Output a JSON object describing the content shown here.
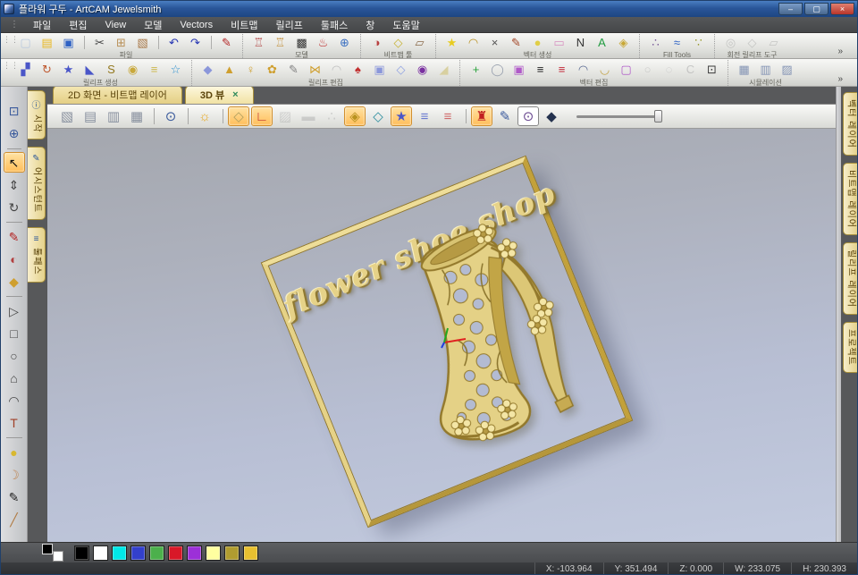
{
  "window": {
    "title": "플라워 구두 - ArtCAM Jewelsmith",
    "controls": [
      {
        "n": "minimize-button",
        "g": "–"
      },
      {
        "n": "maximize-button",
        "g": "▢"
      },
      {
        "n": "close-button",
        "g": "×",
        "cls": "close"
      }
    ]
  },
  "menu": {
    "items": [
      "파일",
      "편집",
      "View",
      "모델",
      "Vectors",
      "비트맵",
      "릴리프",
      "툴패스",
      "창",
      "도움말"
    ]
  },
  "toolbar_overflow": "»",
  "toolbar_row1": {
    "groups": [
      {
        "label": "파일",
        "icons": [
          {
            "n": "new-model-button",
            "g": "▢",
            "c": "#b9c9de"
          },
          {
            "n": "open-model-button",
            "g": "▤",
            "c": "#e9b822"
          },
          {
            "n": "save-model-button",
            "g": "▣",
            "c": "#2f62c4"
          },
          {
            "n": "cut-button",
            "g": "✂",
            "c": "#444",
            "cls": "sb"
          },
          {
            "n": "copy-button",
            "g": "⊞",
            "c": "#b89058"
          },
          {
            "n": "paste-button",
            "g": "▧",
            "c": "#a87848"
          },
          {
            "n": "undo-button",
            "g": "↶",
            "c": "#2636b2",
            "cls": "sb"
          },
          {
            "n": "redo-button",
            "g": "↷",
            "c": "#2636b2"
          },
          {
            "n": "notes-button",
            "g": "✎",
            "c": "#b22222",
            "cls": "sb"
          }
        ]
      },
      {
        "label": "모델",
        "icons": [
          {
            "n": "model-import-red-button",
            "g": "♖",
            "c": "#b04040"
          },
          {
            "n": "model-import-gold-button",
            "g": "♖",
            "c": "#c08a30"
          },
          {
            "n": "model-grayscale-button",
            "g": "▩",
            "c": "#333333"
          },
          {
            "n": "laser-scan-button",
            "g": "♨",
            "c": "#c03030"
          },
          {
            "n": "sphere-model-button",
            "g": "⊕",
            "c": "#3a6fc0"
          }
        ]
      },
      {
        "label": "비트맵 툴",
        "icons": [
          {
            "n": "bitmap-sculpt-button",
            "g": "◑",
            "c": "#b84040"
          },
          {
            "n": "bitmap-to-vector-button",
            "g": "◇",
            "c": "#c6b232"
          },
          {
            "n": "paint-tools-button",
            "g": "▱",
            "c": "#8a6a4a"
          }
        ]
      },
      {
        "label": "벡터 생성",
        "icons": [
          {
            "n": "wand-vector-button",
            "g": "★",
            "c": "#e8cc20"
          },
          {
            "n": "arc-vector-button",
            "g": "◠",
            "c": "#b89020"
          },
          {
            "n": "delete-node-button",
            "g": "×",
            "c": "#555555"
          },
          {
            "n": "curve-pencil-button",
            "g": "✎",
            "c": "#a04020"
          },
          {
            "n": "blob-vector-button",
            "g": "●",
            "c": "#e0ce46"
          },
          {
            "n": "vector-eraser-button",
            "g": "▭",
            "c": "#d890c0"
          },
          {
            "n": "nesting-button",
            "g": "N",
            "c": "#333333"
          },
          {
            "n": "ascii-import-button",
            "g": "A",
            "c": "#1f9a3f"
          },
          {
            "n": "relief-wrap-button",
            "g": "◈",
            "c": "#c8a838"
          }
        ]
      },
      {
        "label": "Fill Tools",
        "icons": [
          {
            "n": "fill-scatter-button",
            "g": "∴",
            "c": "#7a5a9a"
          },
          {
            "n": "fill-flow-button",
            "g": "≈",
            "c": "#2f62c4"
          },
          {
            "n": "fill-nodes-button",
            "g": "∵",
            "c": "#9a9a30"
          }
        ]
      },
      {
        "label": "회전 릴리프 도구",
        "icons": [
          {
            "n": "rotary-relief-button",
            "g": "◎",
            "c": "#999999",
            "cls": "dis"
          },
          {
            "n": "rotary-wrap-button",
            "g": "◇",
            "c": "#999999",
            "cls": "dis"
          },
          {
            "n": "rotary-flat-button",
            "g": "▱",
            "c": "#999999",
            "cls": "dis"
          }
        ]
      }
    ]
  },
  "toolbar_row2": {
    "groups": [
      {
        "label": "릴리프 생성",
        "icons": [
          {
            "n": "shape-editor-button",
            "g": "▞",
            "c": "#4a56c8"
          },
          {
            "n": "sweep-relief-button",
            "g": "↻",
            "c": "#c05a30"
          },
          {
            "n": "star-relief-button",
            "g": "★",
            "c": "#4a56c8"
          },
          {
            "n": "extrude-relief-button",
            "g": "◣",
            "c": "#4a56c8"
          },
          {
            "n": "spin-relief-button",
            "g": "S",
            "c": "#93781e"
          },
          {
            "n": "weave-relief-button",
            "g": "◉",
            "c": "#c9a93c"
          },
          {
            "n": "relief-layers-button",
            "g": "≡",
            "c": "#cdb94e"
          },
          {
            "n": "texture-relief-button",
            "g": "☆",
            "c": "#2a8fd0"
          }
        ]
      },
      {
        "label": "릴리프 편집",
        "icons": [
          {
            "n": "smooth-relief-button",
            "g": "◆",
            "c": "#8b97da"
          },
          {
            "n": "cone-relief-button",
            "g": "▲",
            "c": "#cf9f2e"
          },
          {
            "n": "pin-relief-button",
            "g": "♀",
            "c": "#cf9f2e"
          },
          {
            "n": "flower-relief-button",
            "g": "✿",
            "c": "#cf9f2e"
          },
          {
            "n": "sculpt-relief-button",
            "g": "✎",
            "c": "#808080"
          },
          {
            "n": "spinner-relief-button",
            "g": "⋈",
            "c": "#cf9f2e"
          },
          {
            "n": "dome-relief-button",
            "g": "◠",
            "c": "#bfbfbf"
          },
          {
            "n": "mushroom-relief-button",
            "g": "♠",
            "c": "#c23030"
          },
          {
            "n": "pillow-relief-button",
            "g": "▣",
            "c": "#8b97da"
          },
          {
            "n": "tilt-plane-button",
            "g": "◇",
            "c": "#8fa2e2"
          },
          {
            "n": "sparkle-relief-button",
            "g": "◉",
            "c": "#7a30a0"
          },
          {
            "n": "relief-eraser-button",
            "g": "◢",
            "c": "#d8d0a0"
          }
        ]
      },
      {
        "label": "벡터 편집",
        "icons": [
          {
            "n": "offset-vector-button",
            "g": "+",
            "c": "#2aa43c"
          },
          {
            "n": "ring-vector-button",
            "g": "◯",
            "c": "#98a0ae"
          },
          {
            "n": "emboss-frame-button",
            "g": "▣",
            "c": "#b05ac8"
          },
          {
            "n": "hatch-vector-button",
            "g": "≡",
            "c": "#222222"
          },
          {
            "n": "hatch-star-button",
            "g": "≡",
            "c": "#c22838"
          },
          {
            "n": "arc-node-button",
            "g": "◠",
            "c": "#5a6a92"
          },
          {
            "n": "blob-pair-button",
            "g": "◡",
            "c": "#c2a243"
          },
          {
            "n": "dashed-frame-button",
            "g": "▢",
            "c": "#b05ac8"
          },
          {
            "n": "ghost-blob-button",
            "g": "○",
            "c": "#a5a5a5",
            "cls": "dis"
          },
          {
            "n": "dashed-oval-button",
            "g": "◌",
            "c": "#9a9a9a",
            "cls": "dis"
          },
          {
            "n": "open-contour-button",
            "g": "C",
            "c": "#9a9a9a",
            "cls": "dis"
          },
          {
            "n": "fit-selection-button",
            "g": "⊡",
            "c": "#3a3a3a"
          }
        ]
      },
      {
        "label": "시뮬레이션",
        "icons": [
          {
            "n": "simulate-toolpath-button",
            "g": "▦",
            "c": "#8494b4"
          },
          {
            "n": "simulate-relief-button",
            "g": "▥",
            "c": "#8494b4"
          },
          {
            "n": "simulate-reset-button",
            "g": "▨",
            "c": "#8494b4"
          }
        ]
      }
    ]
  },
  "doc_tabs": [
    {
      "label": "2D 화면 - 비트맵 레이어"
    },
    {
      "label": "3D 뷰",
      "close": "×"
    }
  ],
  "view_toolbar": {
    "icons": [
      {
        "n": "iso-view-button",
        "g": "▧",
        "c": "#88909e"
      },
      {
        "n": "front-view-button",
        "g": "▤",
        "c": "#88909e"
      },
      {
        "n": "side-view-button",
        "g": "▥",
        "c": "#88909e"
      },
      {
        "n": "top-view-button",
        "g": "▦",
        "c": "#88909e"
      },
      {
        "n": "zoom-window-button",
        "g": "⊙",
        "c": "#3a5a9c",
        "cls": "sb"
      },
      {
        "n": "lighting-button",
        "g": "☼",
        "c": "#e8a81e",
        "cls": "sb"
      },
      {
        "n": "draft-plane-toggle",
        "g": "◇",
        "c": "#b0a060",
        "cls": "hl sb"
      },
      {
        "n": "origin-toggle",
        "g": "∟",
        "c": "#c03030",
        "cls": "hl"
      },
      {
        "n": "relief-ghost-button",
        "g": "▨",
        "c": "#aaaaaa",
        "cls": "dis"
      },
      {
        "n": "block-ghost-button",
        "g": "▬",
        "c": "#aaaaaa",
        "cls": "dis"
      },
      {
        "n": "preview-dots-button",
        "g": "∴",
        "c": "#aaaaaa",
        "cls": "dis"
      },
      {
        "n": "show-relief-button",
        "g": "◈",
        "c": "#b89220",
        "cls": "hl"
      },
      {
        "n": "plane-color-button",
        "g": "◇",
        "c": "#2e8fa0"
      },
      {
        "n": "star-overlay-button",
        "g": "★",
        "c": "#4a56c8",
        "cls": "hl"
      },
      {
        "n": "layers-blue-button",
        "g": "≡",
        "c": "#6a7ad0"
      },
      {
        "n": "layers-red-button",
        "g": "≡",
        "c": "#d06a6a"
      },
      {
        "n": "toolpath-sim-button",
        "g": "♜",
        "c": "#c02020",
        "cls": "hl sb"
      },
      {
        "n": "brush-preview-button",
        "g": "✎",
        "c": "#3a5a9c"
      },
      {
        "n": "texture-preview-button",
        "g": "⊙",
        "c": "#6a4890",
        "cls": "on"
      },
      {
        "n": "gradient-shade-button",
        "g": "◆",
        "c": "#24324e"
      }
    ]
  },
  "left_tools": {
    "icons": [
      {
        "n": "zoom-box-tool",
        "g": "⊡",
        "c": "#3a5a9c"
      },
      {
        "n": "wireframe-globe-tool",
        "g": "⊕",
        "c": "#3a5a9c"
      },
      {
        "n": "select-tool",
        "g": "↖",
        "c": "#111111",
        "cls": "hl vsb"
      },
      {
        "n": "transform-tool",
        "g": "⇕",
        "c": "#444444"
      },
      {
        "n": "rotate-tool",
        "g": "↻",
        "c": "#444444"
      },
      {
        "n": "freehand-draw-tool",
        "g": "✎",
        "c": "#b22222",
        "cls": "vsb"
      },
      {
        "n": "paint-sphere-tool",
        "g": "◐",
        "c": "#b24040"
      },
      {
        "n": "bitmap-fold-tool",
        "g": "◆",
        "c": "#cf9f2e"
      },
      {
        "n": "node-edit-tool",
        "g": "▷",
        "c": "#444444",
        "cls": "vsb"
      },
      {
        "n": "rectangle-tool",
        "g": "□",
        "c": "#444444"
      },
      {
        "n": "circle-tool",
        "g": "○",
        "c": "#444444"
      },
      {
        "n": "polygon-tool",
        "g": "⌂",
        "c": "#444444"
      },
      {
        "n": "arc-tool",
        "g": "◠",
        "c": "#444444"
      },
      {
        "n": "text-tool",
        "g": "T",
        "c": "#a04028"
      },
      {
        "n": "droplet-tool",
        "g": "●",
        "c": "#d8b830",
        "cls": "vsb"
      },
      {
        "n": "shell-tool",
        "g": "☽",
        "c": "#c08a5a"
      },
      {
        "n": "calligraphy-pen-tool",
        "g": "✎",
        "c": "#222222"
      },
      {
        "n": "chisel-tool",
        "g": "╱",
        "c": "#b07a42"
      }
    ]
  },
  "left_tabs": {
    "items": [
      {
        "n": "tab-start",
        "icon": "ⓘ",
        "label": "시작"
      },
      {
        "n": "tab-assistant",
        "icon": "✎",
        "label": "어시스턴트"
      },
      {
        "n": "tab-toolpaths",
        "icon": "≡",
        "label": "툴패스"
      }
    ]
  },
  "right_tabs": {
    "items": [
      {
        "n": "tab-vector-layers",
        "label": "벡터 레이어"
      },
      {
        "n": "tab-bitmap-layers",
        "label": "비트맵 레이어"
      },
      {
        "n": "tab-relief-layers",
        "label": "릴리프 레이어"
      },
      {
        "n": "tab-project",
        "label": "프로젝트"
      }
    ]
  },
  "canvas": {
    "plaque_text": "flower shoe shop",
    "gold": "#e4d186",
    "gold_dark": "#c7ab52",
    "background_top": "#a4a7ae",
    "background_bottom": "#c3cbdf",
    "axis_colors": {
      "x": "#e02020",
      "y": "#20a820",
      "z": "#2040e0"
    }
  },
  "palette": {
    "primary": "#000000",
    "secondary": "#ffffff",
    "swatches": [
      "#000000",
      "#ffffff",
      "#00e8e8",
      "#3340cc",
      "#4cb04c",
      "#d81828",
      "#9c30d8",
      "#ffffa0",
      "#b09c30",
      "#e8c030"
    ]
  },
  "status": {
    "segments": [
      "X: -103.964",
      "Y: 351.494",
      "Z: 0.000",
      "W: 233.075",
      "H: 230.393"
    ]
  }
}
